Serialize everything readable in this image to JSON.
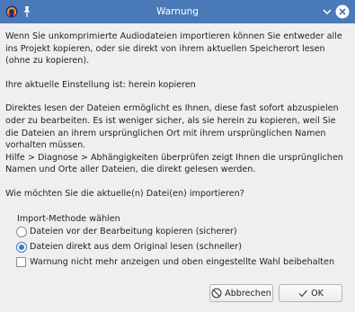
{
  "window": {
    "title": "Warnung",
    "titlebar_color": "#4a79b8"
  },
  "message": {
    "p1": "Wenn Sie unkomprimierte Audiodateien importieren können Sie entweder alle ins Projekt kopieren, oder sie direkt von ihrem aktuellen Speicherort lesen (ohne zu kopieren).",
    "p2": "Ihre aktuelle Einstellung ist: herein kopieren",
    "p3": "Direktes lesen der Dateien ermöglicht es Ihnen, diese fast sofort abzuspielen oder zu bearbeiten. Es ist weniger sicher, als sie herein zu kopieren, weil Sie die Dateien an ihrem ursprünglichen Ort mit ihrem ursprünglichen Namen vorhalten müssen.",
    "p4": "Hilfe > Diagnose > Abhängigkeiten überprüfen zeigt Ihnen die ursprünglichen Namen und Orte aller Dateien, die direkt gelesen werden.",
    "p5": "Wie möchten Sie die aktuelle(n) Datei(en) importieren?"
  },
  "import_method": {
    "title": "Import-Methode wählen",
    "options": [
      {
        "label": "Dateien vor der Bearbeitung kopieren (sicherer)",
        "selected": false
      },
      {
        "label": "Dateien direkt aus dem Original lesen (schneller)",
        "selected": true
      }
    ],
    "dont_warn_label": "Warnung nicht mehr anzeigen und oben eingestellte Wahl beibehalten",
    "dont_warn_checked": false
  },
  "buttons": {
    "cancel_label": "Abbrechen",
    "ok_label": "OK"
  },
  "colors": {
    "accent": "#3c78c4",
    "dialog_bg": "#efefef"
  }
}
